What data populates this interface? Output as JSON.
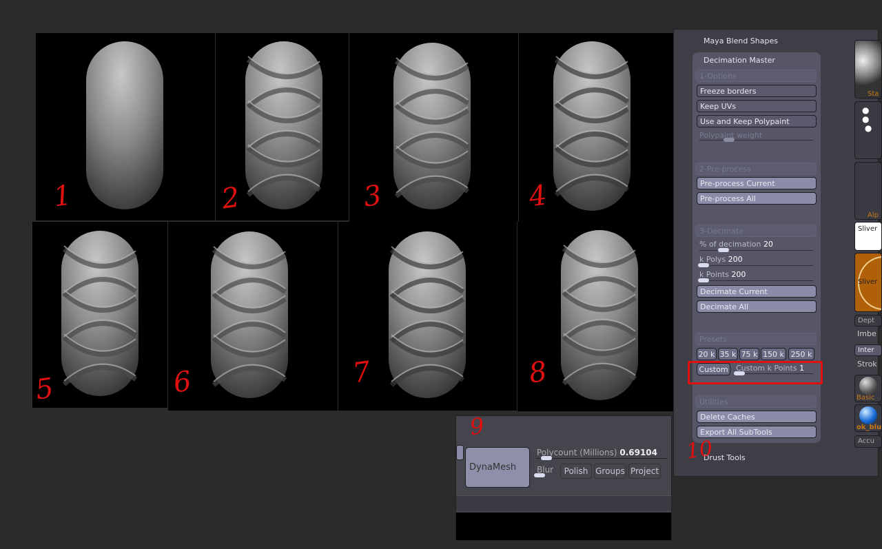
{
  "panels": [
    {
      "label": "1",
      "stage": "smooth"
    },
    {
      "label": "2",
      "stage": "wrinkled"
    },
    {
      "label": "3",
      "stage": "wrinkled"
    },
    {
      "label": "4",
      "stage": "faceted"
    },
    {
      "label": "5",
      "stage": "wrinkled"
    },
    {
      "label": "6",
      "stage": "wrinkled"
    },
    {
      "label": "7",
      "stage": "faceted"
    },
    {
      "label": "8",
      "stage": "wrinkled"
    }
  ],
  "annotations": {
    "dynamesh_mark": "9",
    "drust_mark": "10"
  },
  "zplugin": {
    "maya_blend": "Maya Blend Shapes",
    "title": "Decimation Master",
    "options_header": "1-Options",
    "freeze": "Freeze borders",
    "keep_uvs": "Keep UVs",
    "polypaint": "Use and Keep Polypaint",
    "polypaint_weight": "Polypaint weight",
    "preprocess_header": "2-Pre-process",
    "pre_current": "Pre-process Current",
    "pre_all": "Pre-process All",
    "decimate_header": "3-Decimate",
    "pct_label": "% of decimation",
    "pct_value": "20",
    "kpolys_label": "k Polys",
    "kpolys_value": "200",
    "kpoints_label": "k Points",
    "kpoints_value": "200",
    "dec_current": "Decimate Current",
    "dec_all": "Decimate All",
    "presets_header": "Presets",
    "presets": [
      "20 k",
      "35 k",
      "75 k",
      "150 k",
      "250 k"
    ],
    "custom": "Custom",
    "custom_label": "Custom k Points",
    "custom_value": "1",
    "utilities_header": "Utilities",
    "delete_caches": "Delete Caches",
    "export_all": "Export All SubTools",
    "drust": "Drust Tools"
  },
  "side": {
    "standard": "Sta",
    "alpha": "Alp",
    "stroke_name": "Sliver",
    "brush_name": "Sliver",
    "depth": "Dept",
    "imbed": "Imbe",
    "inter": "Inter",
    "stroke": "Strok",
    "basic": "Basic",
    "ok_blue": "ok_blu",
    "accu": "Accu"
  },
  "dynamesh": {
    "button": "DynaMesh",
    "polycount_label": "Polycount (Millions)",
    "polycount_value": "0.69104",
    "blur": "Blur",
    "polish": "Polish",
    "groups": "Groups",
    "project": "Project"
  },
  "colors": {
    "annotation": "#e01010",
    "accent_orange": "#c8781a"
  }
}
